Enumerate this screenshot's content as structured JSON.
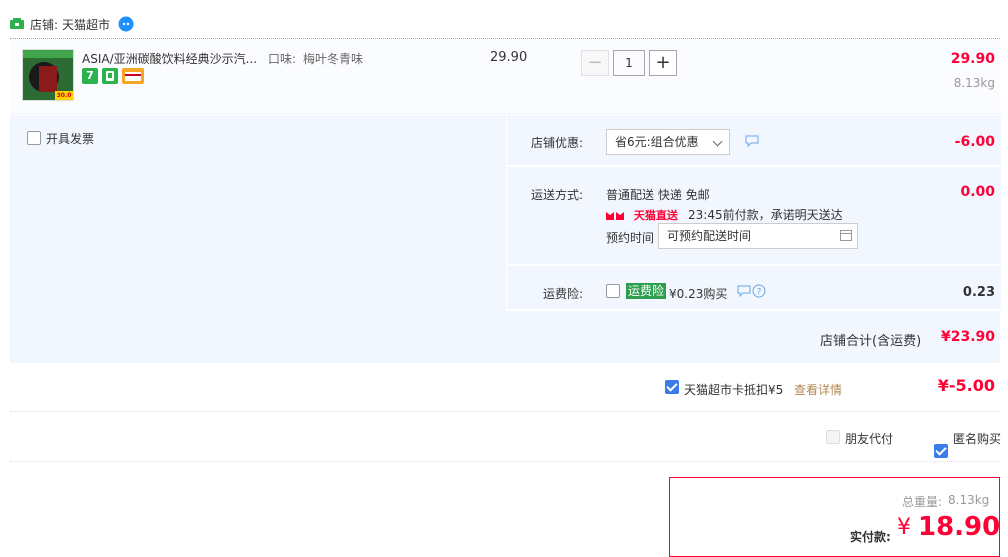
{
  "shop": {
    "label": "店铺:",
    "name": "天猫超市"
  },
  "item": {
    "title": "ASIA/亚洲碳酸饮料经典沙示汽...",
    "attr_label": "口味:",
    "attr_value": "梅叶冬青味",
    "thumb_text": "30.0",
    "badges": [
      {
        "icon": "seven-day-return-icon",
        "text": "7",
        "color": "#2bb24c"
      },
      {
        "icon": "tmall-guarantee-icon",
        "text": "",
        "color": "#2bb24c"
      },
      {
        "icon": "card-payment-icon",
        "text": "",
        "color": "#f5a623"
      }
    ],
    "unit_price": "29.90",
    "quantity": "1",
    "minus": "−",
    "plus": "+",
    "subtotal": "29.90",
    "weight": "8.13kg"
  },
  "options": {
    "invoice_label": "开具发票",
    "discount": {
      "label": "店铺优惠:",
      "selected": "省6元:组合优惠",
      "amount": "-6.00"
    },
    "shipping": {
      "label": "运送方式:",
      "method": "普通配送 快递 免邮",
      "tmall_tag": "天猫直送",
      "promise": "23:45前付款，承诺明天送达",
      "schedule_label": "预约时间",
      "schedule_placeholder": "可预约配送时间",
      "amount": "0.00"
    },
    "insurance": {
      "label": "运费险:",
      "tag": "运费险",
      "price": "¥0.23购买",
      "amount": "0.23"
    }
  },
  "shop_total": {
    "label": "店铺合计(含运费)",
    "amount": "¥23.90"
  },
  "card_deduct": {
    "label": "天猫超市卡抵扣¥5",
    "link": "查看详情",
    "amount": "¥-5.00"
  },
  "extras": {
    "friend_pay": "朋友代付",
    "anonymous": "匿名购买"
  },
  "pay": {
    "weight_label": "总重量:",
    "weight": "8.13kg",
    "label": "实付款:",
    "currency": "¥",
    "amount": "18.90"
  },
  "colors": {
    "accent": "#ff0036",
    "panel": "#f2f7ff",
    "brand_blue": "#3a7de8"
  }
}
